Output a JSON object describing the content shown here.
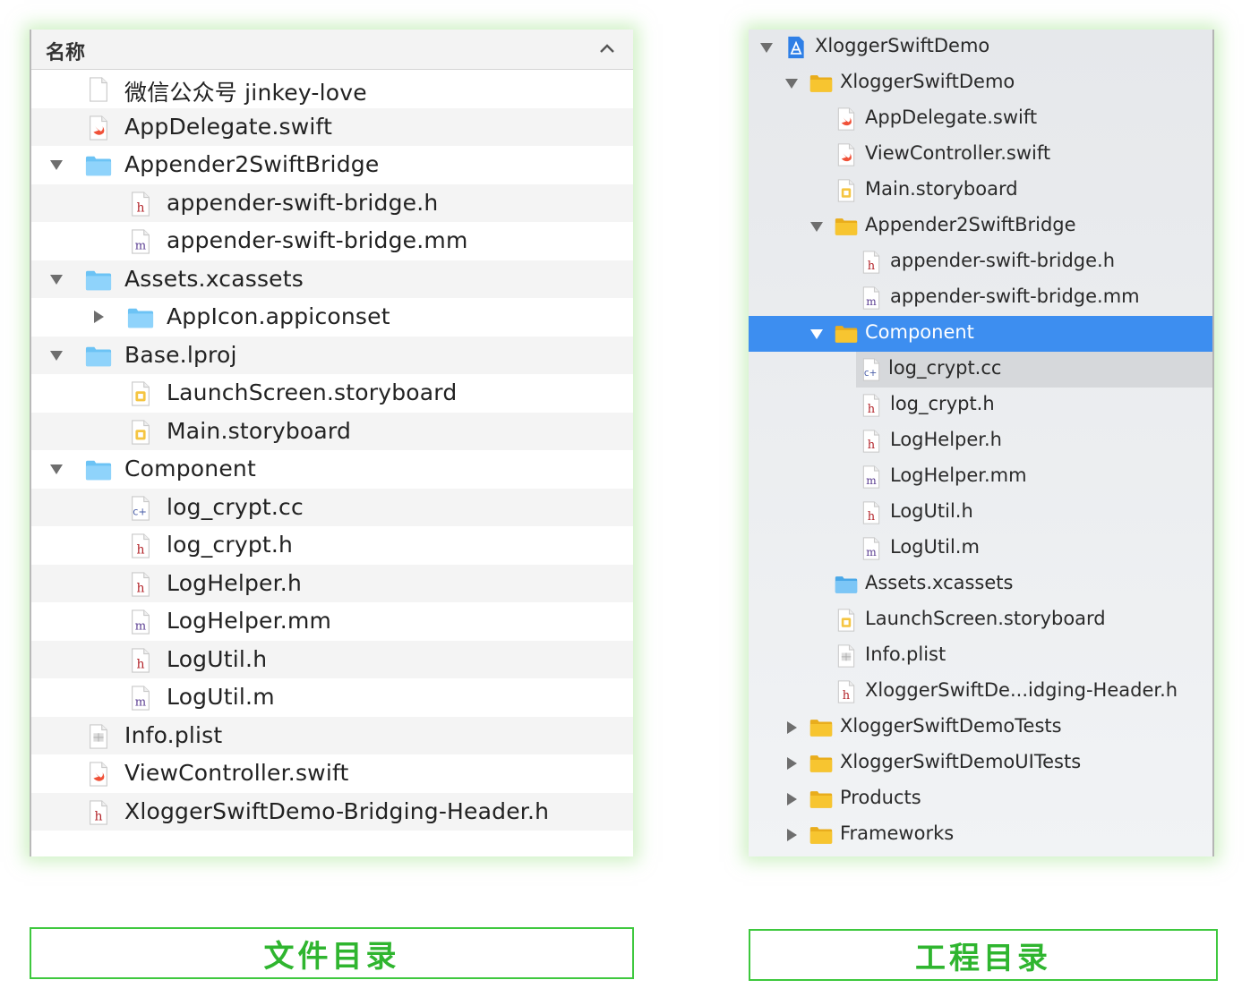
{
  "finder": {
    "column_header": "名称",
    "rows": [
      {
        "label": "微信公众号 jinkey-love",
        "icon": "blank-file-icon",
        "indent": 0,
        "disclosure": "none"
      },
      {
        "label": "AppDelegate.swift",
        "icon": "swift-file-icon",
        "indent": 0,
        "disclosure": "none"
      },
      {
        "label": "Appender2SwiftBridge",
        "icon": "folder-icon",
        "indent": 0,
        "disclosure": "open"
      },
      {
        "label": "appender-swift-bridge.h",
        "icon": "header-file-icon",
        "indent": 1,
        "disclosure": "none"
      },
      {
        "label": "appender-swift-bridge.mm",
        "icon": "objc-file-icon",
        "indent": 1,
        "disclosure": "none"
      },
      {
        "label": "Assets.xcassets",
        "icon": "folder-icon",
        "indent": 0,
        "disclosure": "open"
      },
      {
        "label": "AppIcon.appiconset",
        "icon": "folder-icon",
        "indent": 1,
        "disclosure": "closed"
      },
      {
        "label": "Base.lproj",
        "icon": "folder-icon",
        "indent": 0,
        "disclosure": "open"
      },
      {
        "label": "LaunchScreen.storyboard",
        "icon": "storyboard-file-icon",
        "indent": 1,
        "disclosure": "none"
      },
      {
        "label": "Main.storyboard",
        "icon": "storyboard-file-icon",
        "indent": 1,
        "disclosure": "none"
      },
      {
        "label": "Component",
        "icon": "folder-icon",
        "indent": 0,
        "disclosure": "open"
      },
      {
        "label": "log_crypt.cc",
        "icon": "cpp-file-icon",
        "indent": 1,
        "disclosure": "none"
      },
      {
        "label": "log_crypt.h",
        "icon": "header-file-icon",
        "indent": 1,
        "disclosure": "none"
      },
      {
        "label": "LogHelper.h",
        "icon": "header-file-icon",
        "indent": 1,
        "disclosure": "none"
      },
      {
        "label": "LogHelper.mm",
        "icon": "objc-file-icon",
        "indent": 1,
        "disclosure": "none"
      },
      {
        "label": "LogUtil.h",
        "icon": "header-file-icon",
        "indent": 1,
        "disclosure": "none"
      },
      {
        "label": "LogUtil.m",
        "icon": "objc-file-icon",
        "indent": 1,
        "disclosure": "none"
      },
      {
        "label": "Info.plist",
        "icon": "plist-file-icon",
        "indent": 0,
        "disclosure": "none"
      },
      {
        "label": "ViewController.swift",
        "icon": "swift-file-icon",
        "indent": 0,
        "disclosure": "none"
      },
      {
        "label": "XloggerSwiftDemo-Bridging-Header.h",
        "icon": "header-file-icon",
        "indent": 0,
        "disclosure": "none"
      }
    ]
  },
  "xcode": {
    "rows": [
      {
        "label": "XloggerSwiftDemo",
        "icon": "project-icon",
        "indent": 0,
        "disclosure": "open"
      },
      {
        "label": "XloggerSwiftDemo",
        "icon": "yellow-folder-icon",
        "indent": 1,
        "disclosure": "open"
      },
      {
        "label": "AppDelegate.swift",
        "icon": "swift-file-icon",
        "indent": 2,
        "disclosure": "none"
      },
      {
        "label": "ViewController.swift",
        "icon": "swift-file-icon",
        "indent": 2,
        "disclosure": "none"
      },
      {
        "label": "Main.storyboard",
        "icon": "storyboard-file-icon",
        "indent": 2,
        "disclosure": "none"
      },
      {
        "label": "Appender2SwiftBridge",
        "icon": "yellow-folder-icon",
        "indent": 2,
        "disclosure": "open"
      },
      {
        "label": "appender-swift-bridge.h",
        "icon": "header-file-icon",
        "indent": 3,
        "disclosure": "none"
      },
      {
        "label": "appender-swift-bridge.mm",
        "icon": "objc-file-icon",
        "indent": 3,
        "disclosure": "none"
      },
      {
        "label": "Component",
        "icon": "yellow-folder-icon",
        "indent": 2,
        "disclosure": "open",
        "selected": true
      },
      {
        "label": "log_crypt.cc",
        "icon": "cpp-file-icon",
        "indent": 3,
        "disclosure": "none",
        "focus": true
      },
      {
        "label": "log_crypt.h",
        "icon": "header-file-icon",
        "indent": 3,
        "disclosure": "none"
      },
      {
        "label": "LogHelper.h",
        "icon": "header-file-icon",
        "indent": 3,
        "disclosure": "none"
      },
      {
        "label": "LogHelper.mm",
        "icon": "objc-file-icon",
        "indent": 3,
        "disclosure": "none"
      },
      {
        "label": "LogUtil.h",
        "icon": "header-file-icon",
        "indent": 3,
        "disclosure": "none"
      },
      {
        "label": "LogUtil.m",
        "icon": "objc-file-icon",
        "indent": 3,
        "disclosure": "none"
      },
      {
        "label": "Assets.xcassets",
        "icon": "blue-folder-icon",
        "indent": 2,
        "disclosure": "none"
      },
      {
        "label": "LaunchScreen.storyboard",
        "icon": "storyboard-file-icon",
        "indent": 2,
        "disclosure": "none"
      },
      {
        "label": "Info.plist",
        "icon": "plist-file-icon",
        "indent": 2,
        "disclosure": "none"
      },
      {
        "label": "XloggerSwiftDe...idging-Header.h",
        "icon": "header-file-icon",
        "indent": 2,
        "disclosure": "none"
      },
      {
        "label": "XloggerSwiftDemoTests",
        "icon": "yellow-folder-icon",
        "indent": 1,
        "disclosure": "closed"
      },
      {
        "label": "XloggerSwiftDemoUITests",
        "icon": "yellow-folder-icon",
        "indent": 1,
        "disclosure": "closed"
      },
      {
        "label": "Products",
        "icon": "yellow-folder-icon",
        "indent": 1,
        "disclosure": "closed"
      },
      {
        "label": "Frameworks",
        "icon": "yellow-folder-icon",
        "indent": 1,
        "disclosure": "closed"
      }
    ]
  },
  "captions": {
    "left": "文件目录",
    "right": "工程目录"
  },
  "colors": {
    "accent_green": "#3ec83e",
    "selection_blue": "#3d8ef0",
    "finder_folder": "#6cc3f5",
    "xcode_folder": "#f7c530",
    "swift_orange": "#f05138",
    "header_red": "#b3242a",
    "objc_purple": "#5a3d91"
  }
}
